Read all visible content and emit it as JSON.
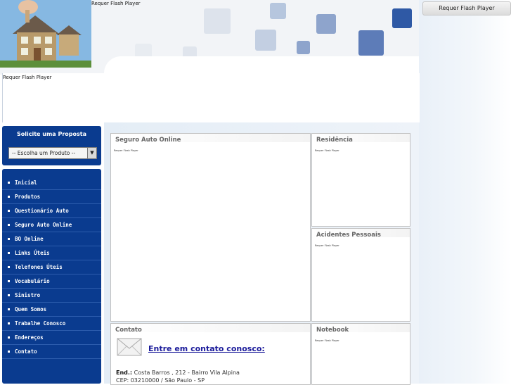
{
  "flash_button": {
    "label": "Requer Flash Player"
  },
  "header": {
    "flash_label": "Requer Flash Player"
  },
  "banner": {
    "flash_label": "Requer Flash Player"
  },
  "proposta": {
    "title": "Solicite uma Proposta",
    "select_value": "-- Escolha um Produto --"
  },
  "menu": {
    "items": [
      "Inicial",
      "Produtos",
      "Questionário Auto",
      "Seguro Auto Online",
      "BO Online",
      "Links Úteis",
      "Telefones Úteis",
      "Vocabulário",
      "Sinistro",
      "Quem Somos",
      "Trabalhe Conosco",
      "Endereços",
      "Contato"
    ]
  },
  "panels": {
    "seguro": {
      "title": "Seguro Auto Online",
      "flash_label": "Requer Flash Player"
    },
    "residencia": {
      "title": "Residência",
      "flash_label": "Requer Flash Player"
    },
    "acidentes": {
      "title": "Acidentes Pessoais",
      "flash_label": "Requer Flash Player"
    },
    "notebook": {
      "title": "Notebook",
      "flash_label": "Requer Flash Player"
    },
    "contato": {
      "title": "Contato",
      "link": "Entre em contato conosco:",
      "end_label": "End.:",
      "address": "Costa Barros , 212 - Bairro Vila Alpina",
      "cep": "CEP: 03210000 / São Paulo - SP"
    }
  },
  "colors": {
    "menu_bg": "#0a3b8f",
    "title_gray": "#666666",
    "link": "#1a1a9a"
  }
}
